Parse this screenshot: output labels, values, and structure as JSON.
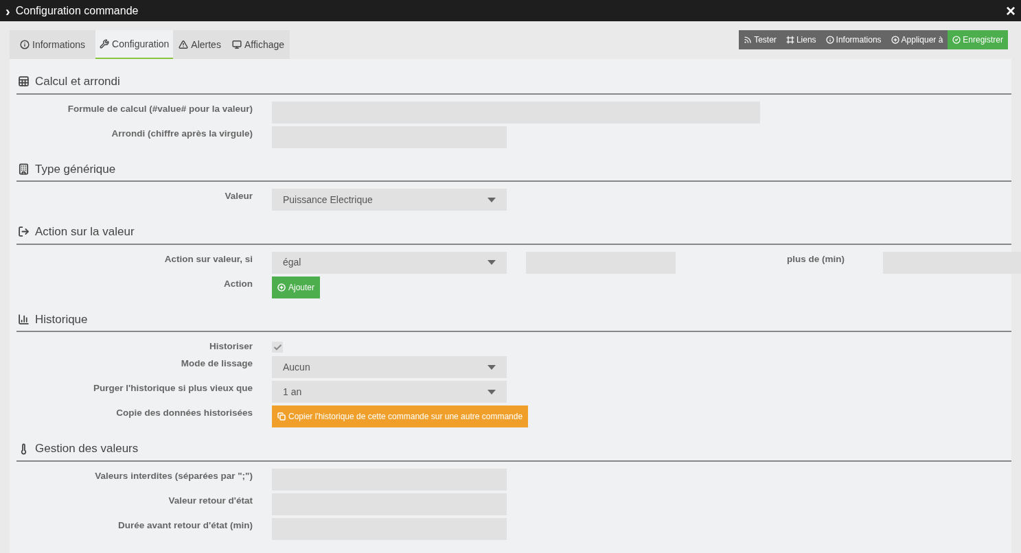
{
  "window": {
    "title": "Configuration commande",
    "collapse_glyph": "›",
    "close_glyph": "×"
  },
  "tabs": [
    {
      "label": "Informations",
      "selected": false
    },
    {
      "label": "Configuration",
      "selected": true
    },
    {
      "label": "Alertes",
      "selected": false
    },
    {
      "label": "Affichage",
      "selected": false
    }
  ],
  "toolbar": [
    {
      "label": "Tester",
      "kind": "default"
    },
    {
      "label": "Liens",
      "kind": "default"
    },
    {
      "label": "Informations",
      "kind": "default"
    },
    {
      "label": "Appliquer à",
      "kind": "default"
    },
    {
      "label": "Enregistrer",
      "kind": "success"
    }
  ],
  "sections": [
    {
      "title": "Calcul et arrondi",
      "rows": [
        {
          "label": "Formule de calcul (#value# pour la valeur)",
          "controls": [
            {
              "kind": "widefield"
            }
          ]
        },
        {
          "label": "Arrondi (chiffre après la virgule)",
          "controls": [
            {
              "kind": "field"
            }
          ]
        }
      ]
    },
    {
      "title": "Type générique",
      "rows": [
        {
          "label": "Valeur",
          "controls": [
            {
              "kind": "select",
              "value": "Puissance Electrique"
            }
          ]
        }
      ]
    },
    {
      "title": "Action sur la valeur",
      "rows": [
        {
          "label": "Action sur valeur, si",
          "controls": [
            {
              "kind": "select",
              "value": "égal"
            },
            {
              "kind": "shortfield"
            },
            {
              "kind": "label",
              "text": "plus de (min)"
            },
            {
              "kind": "shortfield"
            }
          ]
        },
        {
          "label": "Action",
          "controls": [
            {
              "kind": "addbutton",
              "text": "Ajouter",
              "color": "#4cae4c"
            }
          ]
        }
      ]
    },
    {
      "title": "Historique",
      "rows": [
        {
          "label": "Historiser",
          "controls": [
            {
              "kind": "checkbox",
              "checked": true
            }
          ]
        },
        {
          "label": "Mode de lissage",
          "controls": [
            {
              "kind": "select",
              "value": "Aucun"
            }
          ]
        },
        {
          "label": "Purger l'historique si plus vieux que",
          "controls": [
            {
              "kind": "select",
              "value": "1 an"
            }
          ]
        },
        {
          "label": "Copie des données historisées",
          "controls": [
            {
              "kind": "copybutton",
              "text": "Copier l'historique de cette commande sur une autre commande",
              "color": "#f0a02a"
            }
          ]
        }
      ]
    },
    {
      "title": "Gestion des valeurs",
      "rows": [
        {
          "label": "Valeurs interdites (séparées par \";\")",
          "controls": [
            {
              "kind": "field"
            }
          ]
        },
        {
          "label": "Valeur retour d'état",
          "controls": [
            {
              "kind": "field"
            }
          ]
        },
        {
          "label": "Durée avant retour d'état (min)",
          "controls": [
            {
              "kind": "field"
            }
          ]
        }
      ]
    }
  ]
}
